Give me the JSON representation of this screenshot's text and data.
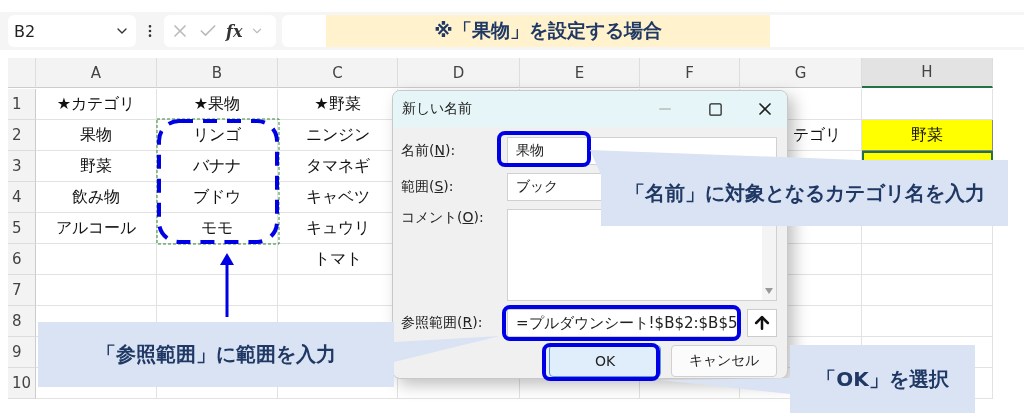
{
  "banner": "※「果物」を設定する場合",
  "formula_bar": {
    "name_box": "B2",
    "fx": "fx"
  },
  "columns": [
    {
      "label": "A",
      "selected": false
    },
    {
      "label": "B",
      "selected": false
    },
    {
      "label": "C",
      "selected": false
    },
    {
      "label": "D",
      "selected": false
    },
    {
      "label": "E",
      "selected": false
    },
    {
      "label": "F",
      "selected": false
    },
    {
      "label": "G",
      "selected": false
    },
    {
      "label": "H",
      "selected": true
    }
  ],
  "rows": [
    {
      "number": "1",
      "cells": [
        {
          "text": "★カテゴリ"
        },
        {
          "text": "★果物"
        },
        {
          "text": "★野菜"
        }
      ]
    },
    {
      "number": "2",
      "cells": [
        {
          "text": "果物"
        },
        {
          "text": "リンゴ"
        },
        {
          "text": "ニンジン"
        },
        null,
        null,
        null,
        {
          "text": "テゴリ"
        },
        {
          "text": "野菜",
          "highlight": true,
          "selected": false
        }
      ]
    },
    {
      "number": "3",
      "cells": [
        {
          "text": "野菜"
        },
        {
          "text": "バナナ"
        },
        {
          "text": "タマネギ"
        },
        null,
        null,
        null,
        null,
        {
          "highlight": true,
          "selected": true
        }
      ]
    },
    {
      "number": "4",
      "cells": [
        {
          "text": "飲み物"
        },
        {
          "text": "ブドウ"
        },
        {
          "text": "キャベツ"
        }
      ]
    },
    {
      "number": "5",
      "cells": [
        {
          "text": "アルコール"
        },
        {
          "text": "モモ"
        },
        {
          "text": "キュウリ"
        }
      ]
    },
    {
      "number": "6",
      "cells": [
        null,
        null,
        {
          "text": "トマト"
        }
      ]
    },
    {
      "number": "7"
    },
    {
      "number": "8"
    },
    {
      "number": "9"
    },
    {
      "number": "10"
    }
  ],
  "dialog": {
    "title": "新しい名前",
    "fields": [
      {
        "kind": "text",
        "label": {
          "before": "名前(",
          "key": "N",
          "after": "):"
        },
        "value": "果物"
      },
      {
        "kind": "select",
        "label": {
          "before": "範囲(",
          "key": "S",
          "after": "):"
        },
        "value": "ブック"
      },
      {
        "kind": "textarea",
        "label": {
          "before": "コメント(",
          "key": "O",
          "after": "):"
        }
      },
      {
        "kind": "reference",
        "label": {
          "before": "参照範囲(",
          "key": "R",
          "after": "):"
        },
        "value": "=プルダウンシート!$B$2:$B$5"
      }
    ],
    "buttons": [
      {
        "label": "OK",
        "default": true
      },
      {
        "label": "キャンセル",
        "default": false
      }
    ]
  },
  "callouts": [
    {
      "text": "「名前」に対象となるカテゴリ名を入力"
    },
    {
      "text": "「参照範囲」に範囲を入力"
    },
    {
      "text": "「OK」を選択"
    }
  ]
}
